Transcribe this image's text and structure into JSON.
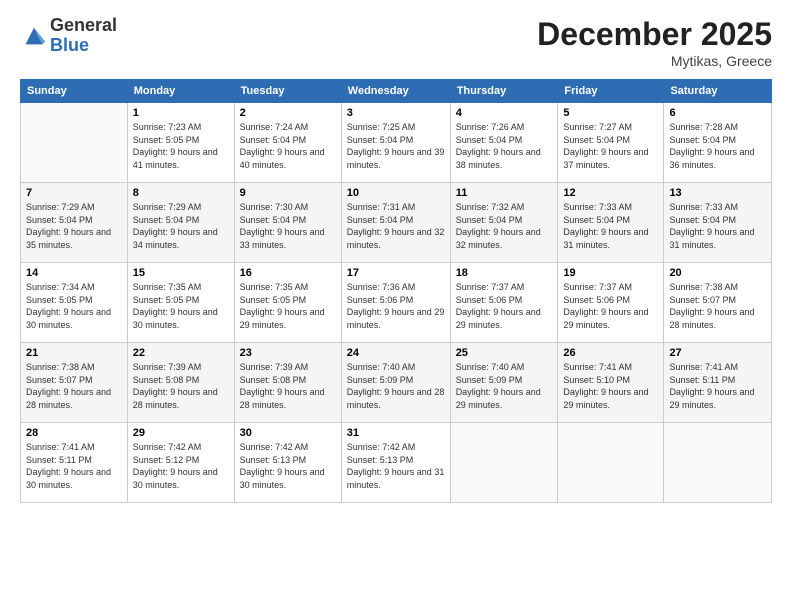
{
  "logo": {
    "general": "General",
    "blue": "Blue"
  },
  "title": "December 2025",
  "location": "Mytikas, Greece",
  "days_header": [
    "Sunday",
    "Monday",
    "Tuesday",
    "Wednesday",
    "Thursday",
    "Friday",
    "Saturday"
  ],
  "weeks": [
    [
      {
        "num": "",
        "sunrise": "",
        "sunset": "",
        "daylight": ""
      },
      {
        "num": "1",
        "sunrise": "Sunrise: 7:23 AM",
        "sunset": "Sunset: 5:05 PM",
        "daylight": "Daylight: 9 hours and 41 minutes."
      },
      {
        "num": "2",
        "sunrise": "Sunrise: 7:24 AM",
        "sunset": "Sunset: 5:04 PM",
        "daylight": "Daylight: 9 hours and 40 minutes."
      },
      {
        "num": "3",
        "sunrise": "Sunrise: 7:25 AM",
        "sunset": "Sunset: 5:04 PM",
        "daylight": "Daylight: 9 hours and 39 minutes."
      },
      {
        "num": "4",
        "sunrise": "Sunrise: 7:26 AM",
        "sunset": "Sunset: 5:04 PM",
        "daylight": "Daylight: 9 hours and 38 minutes."
      },
      {
        "num": "5",
        "sunrise": "Sunrise: 7:27 AM",
        "sunset": "Sunset: 5:04 PM",
        "daylight": "Daylight: 9 hours and 37 minutes."
      },
      {
        "num": "6",
        "sunrise": "Sunrise: 7:28 AM",
        "sunset": "Sunset: 5:04 PM",
        "daylight": "Daylight: 9 hours and 36 minutes."
      }
    ],
    [
      {
        "num": "7",
        "sunrise": "Sunrise: 7:29 AM",
        "sunset": "Sunset: 5:04 PM",
        "daylight": "Daylight: 9 hours and 35 minutes."
      },
      {
        "num": "8",
        "sunrise": "Sunrise: 7:29 AM",
        "sunset": "Sunset: 5:04 PM",
        "daylight": "Daylight: 9 hours and 34 minutes."
      },
      {
        "num": "9",
        "sunrise": "Sunrise: 7:30 AM",
        "sunset": "Sunset: 5:04 PM",
        "daylight": "Daylight: 9 hours and 33 minutes."
      },
      {
        "num": "10",
        "sunrise": "Sunrise: 7:31 AM",
        "sunset": "Sunset: 5:04 PM",
        "daylight": "Daylight: 9 hours and 32 minutes."
      },
      {
        "num": "11",
        "sunrise": "Sunrise: 7:32 AM",
        "sunset": "Sunset: 5:04 PM",
        "daylight": "Daylight: 9 hours and 32 minutes."
      },
      {
        "num": "12",
        "sunrise": "Sunrise: 7:33 AM",
        "sunset": "Sunset: 5:04 PM",
        "daylight": "Daylight: 9 hours and 31 minutes."
      },
      {
        "num": "13",
        "sunrise": "Sunrise: 7:33 AM",
        "sunset": "Sunset: 5:04 PM",
        "daylight": "Daylight: 9 hours and 31 minutes."
      }
    ],
    [
      {
        "num": "14",
        "sunrise": "Sunrise: 7:34 AM",
        "sunset": "Sunset: 5:05 PM",
        "daylight": "Daylight: 9 hours and 30 minutes."
      },
      {
        "num": "15",
        "sunrise": "Sunrise: 7:35 AM",
        "sunset": "Sunset: 5:05 PM",
        "daylight": "Daylight: 9 hours and 30 minutes."
      },
      {
        "num": "16",
        "sunrise": "Sunrise: 7:35 AM",
        "sunset": "Sunset: 5:05 PM",
        "daylight": "Daylight: 9 hours and 29 minutes."
      },
      {
        "num": "17",
        "sunrise": "Sunrise: 7:36 AM",
        "sunset": "Sunset: 5:06 PM",
        "daylight": "Daylight: 9 hours and 29 minutes."
      },
      {
        "num": "18",
        "sunrise": "Sunrise: 7:37 AM",
        "sunset": "Sunset: 5:06 PM",
        "daylight": "Daylight: 9 hours and 29 minutes."
      },
      {
        "num": "19",
        "sunrise": "Sunrise: 7:37 AM",
        "sunset": "Sunset: 5:06 PM",
        "daylight": "Daylight: 9 hours and 29 minutes."
      },
      {
        "num": "20",
        "sunrise": "Sunrise: 7:38 AM",
        "sunset": "Sunset: 5:07 PM",
        "daylight": "Daylight: 9 hours and 28 minutes."
      }
    ],
    [
      {
        "num": "21",
        "sunrise": "Sunrise: 7:38 AM",
        "sunset": "Sunset: 5:07 PM",
        "daylight": "Daylight: 9 hours and 28 minutes."
      },
      {
        "num": "22",
        "sunrise": "Sunrise: 7:39 AM",
        "sunset": "Sunset: 5:08 PM",
        "daylight": "Daylight: 9 hours and 28 minutes."
      },
      {
        "num": "23",
        "sunrise": "Sunrise: 7:39 AM",
        "sunset": "Sunset: 5:08 PM",
        "daylight": "Daylight: 9 hours and 28 minutes."
      },
      {
        "num": "24",
        "sunrise": "Sunrise: 7:40 AM",
        "sunset": "Sunset: 5:09 PM",
        "daylight": "Daylight: 9 hours and 28 minutes."
      },
      {
        "num": "25",
        "sunrise": "Sunrise: 7:40 AM",
        "sunset": "Sunset: 5:09 PM",
        "daylight": "Daylight: 9 hours and 29 minutes."
      },
      {
        "num": "26",
        "sunrise": "Sunrise: 7:41 AM",
        "sunset": "Sunset: 5:10 PM",
        "daylight": "Daylight: 9 hours and 29 minutes."
      },
      {
        "num": "27",
        "sunrise": "Sunrise: 7:41 AM",
        "sunset": "Sunset: 5:11 PM",
        "daylight": "Daylight: 9 hours and 29 minutes."
      }
    ],
    [
      {
        "num": "28",
        "sunrise": "Sunrise: 7:41 AM",
        "sunset": "Sunset: 5:11 PM",
        "daylight": "Daylight: 9 hours and 30 minutes."
      },
      {
        "num": "29",
        "sunrise": "Sunrise: 7:42 AM",
        "sunset": "Sunset: 5:12 PM",
        "daylight": "Daylight: 9 hours and 30 minutes."
      },
      {
        "num": "30",
        "sunrise": "Sunrise: 7:42 AM",
        "sunset": "Sunset: 5:13 PM",
        "daylight": "Daylight: 9 hours and 30 minutes."
      },
      {
        "num": "31",
        "sunrise": "Sunrise: 7:42 AM",
        "sunset": "Sunset: 5:13 PM",
        "daylight": "Daylight: 9 hours and 31 minutes."
      },
      {
        "num": "",
        "sunrise": "",
        "sunset": "",
        "daylight": ""
      },
      {
        "num": "",
        "sunrise": "",
        "sunset": "",
        "daylight": ""
      },
      {
        "num": "",
        "sunrise": "",
        "sunset": "",
        "daylight": ""
      }
    ]
  ]
}
